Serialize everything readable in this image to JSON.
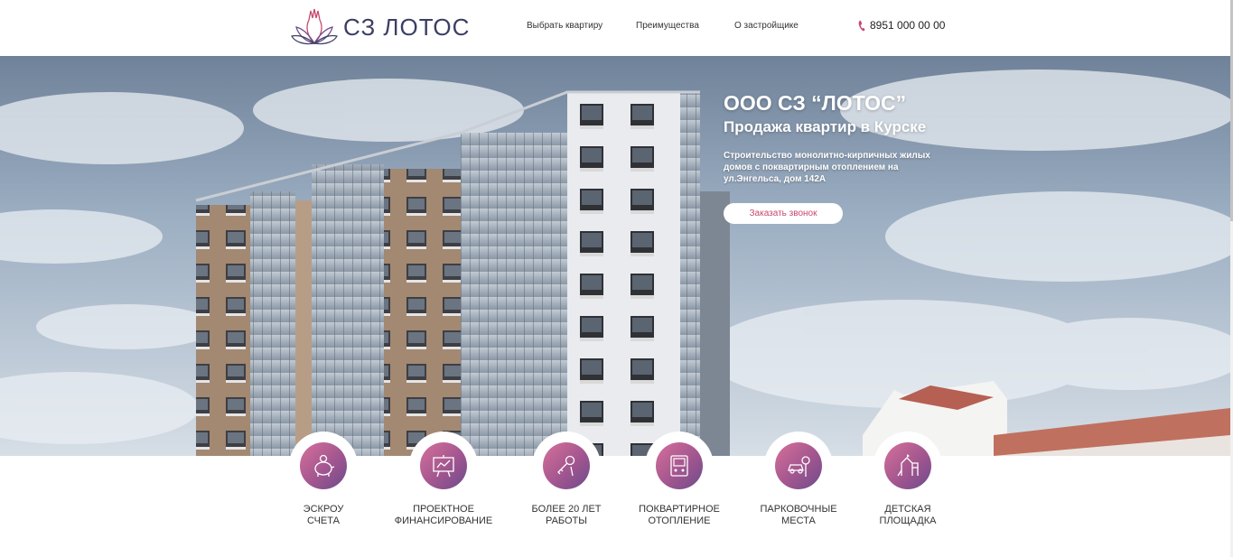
{
  "header": {
    "logo_text": "СЗ ЛОТОС",
    "nav": [
      {
        "label": "Выбрать квартиру"
      },
      {
        "label": "Преимущества"
      },
      {
        "label": "О застройщике"
      }
    ],
    "phone": "8951 000 00 00",
    "phone_icon": "phone-icon"
  },
  "hero": {
    "title": "ООО СЗ “ЛОТОС”",
    "subtitle": "Продажа квартир в Курске",
    "description": "Строительство монолитно-кирпичных жилых домов с поквартирным отоплением на ул.Энгельса, дом 142А",
    "cta_label": "Заказать звонок"
  },
  "features": [
    {
      "line1": "Эскроу",
      "line2": "счета",
      "icon": "piggy-bank-icon"
    },
    {
      "line1": "Проектное",
      "line2": "финансирование",
      "icon": "presentation-board-icon"
    },
    {
      "line1": "Более 20 лет",
      "line2": "работы",
      "icon": "keys-icon"
    },
    {
      "line1": "Поквартирное",
      "line2": "отопление",
      "icon": "boiler-icon"
    },
    {
      "line1": "Парковочные",
      "line2": "места",
      "icon": "car-icon"
    },
    {
      "line1": "Детская",
      "line2": "площадка",
      "icon": "playground-icon"
    }
  ],
  "colors": {
    "accent": "#c9466d",
    "gradient_start": "#d7709b",
    "gradient_end": "#6d4a8c",
    "logo_text": "#3b3f63"
  }
}
